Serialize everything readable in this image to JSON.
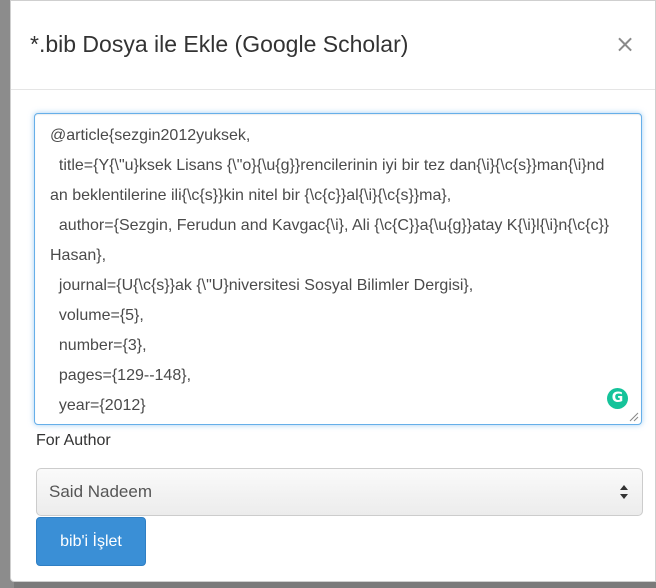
{
  "modal": {
    "title": "*.bib Dosya ile Ekle (Google Scholar)",
    "close_label": "×"
  },
  "bib_input": {
    "value": "@article{sezgin2012yuksek,\n  title={Y{\\\"u}ksek Lisans {\\\"o}{\\u{g}}rencilerinin iyi bir tez dan{\\i}{\\c{s}}man{\\i}ndan beklentilerine ili{\\c{s}}kin nitel bir {\\c{c}}al{\\i}{\\c{s}}ma},\n  author={Sezgin, Ferudun and Kavgac{\\i}, Ali {\\c{C}}a{\\u{g}}atay K{\\i}l{\\i}n{\\c{c}} Hasan},\n  journal={U{\\c{s}}ak {\\\"U}niversitesi Sosyal Bilimler Dergisi},\n  volume={5},\n  number={3},\n  pages={129--148},\n  year={2012}\n}",
    "grammarly_icon": "grammarly-icon"
  },
  "author_field": {
    "label": "For Author",
    "selected": "Said Nadeem"
  },
  "actions": {
    "process_label": "bib'i İşlet"
  },
  "colors": {
    "primary_button": "#3a8fd6",
    "focus_border": "#66afe9",
    "grammarly": "#15c39a"
  }
}
